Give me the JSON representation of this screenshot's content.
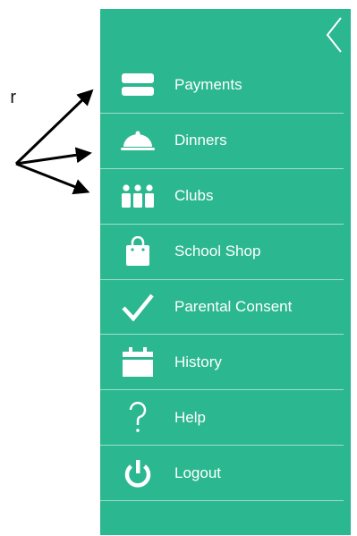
{
  "annotation": {
    "text": "r"
  },
  "menu": {
    "items": [
      {
        "label": "Payments",
        "icon": "card-icon"
      },
      {
        "label": "Dinners",
        "icon": "cloche-icon"
      },
      {
        "label": "Clubs",
        "icon": "people-icon"
      },
      {
        "label": "School Shop",
        "icon": "shopping-bag-icon"
      },
      {
        "label": "Parental Consent",
        "icon": "checkmark-icon"
      },
      {
        "label": "History",
        "icon": "calendar-icon"
      },
      {
        "label": "Help",
        "icon": "question-mark-icon"
      },
      {
        "label": "Logout",
        "icon": "power-icon"
      }
    ]
  },
  "colors": {
    "panel": "#2bb78f",
    "text": "#ffffff",
    "arrow": "#000000"
  }
}
